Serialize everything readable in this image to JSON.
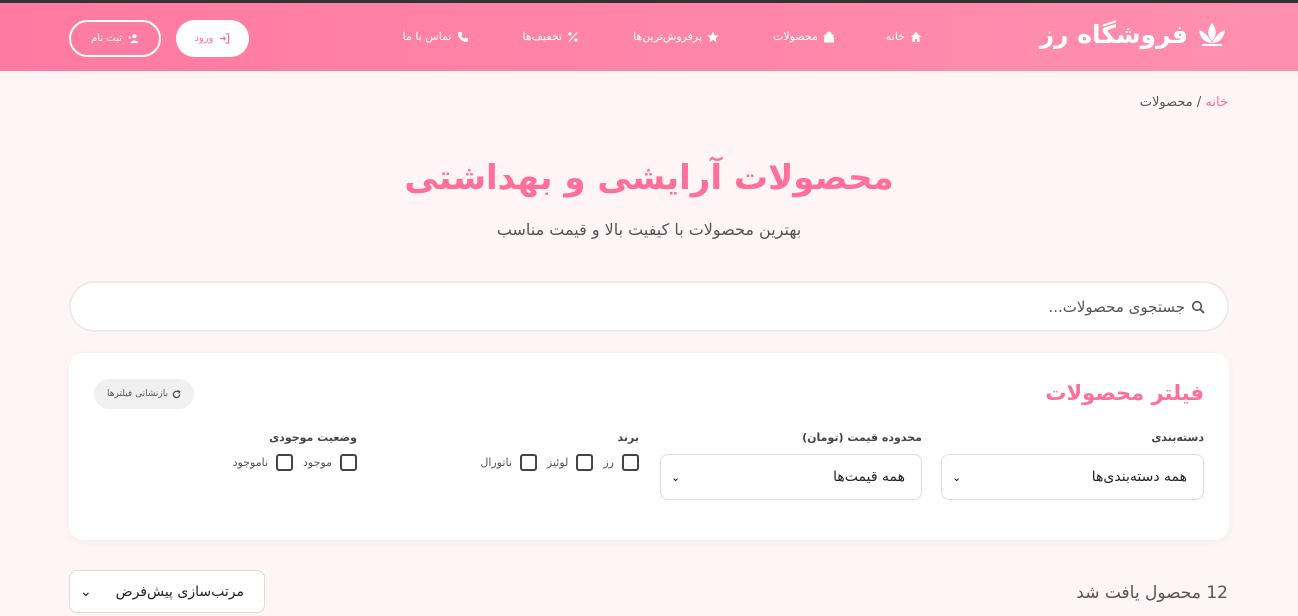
{
  "header": {
    "brand": "فروشگاه رز",
    "nav": [
      {
        "label": "خانه",
        "icon": "home-icon"
      },
      {
        "label": "محصولات",
        "icon": "bag-icon"
      },
      {
        "label": "پرفروش‌ترین‌ها",
        "icon": "star-icon"
      },
      {
        "label": "تخفیف‌ها",
        "icon": "percent-icon"
      },
      {
        "label": "تماس با ما",
        "icon": "phone-icon"
      }
    ],
    "login_label": "ورود",
    "register_label": "ثبت نام"
  },
  "breadcrumb": {
    "home": "خانه",
    "separator": "/",
    "current": "محصولات"
  },
  "hero": {
    "title": "محصولات آرایشی و بهداشتی",
    "subtitle": "بهترین محصولات با کیفیت بالا و قیمت مناسب"
  },
  "search": {
    "placeholder": "جستجوی محصولات..."
  },
  "filters": {
    "title": "فیلتر محصولات",
    "reset_label": "بازنشانی فیلترها",
    "category": {
      "label": "دسته‌بندی",
      "selected": "همه دسته‌بندی‌ها"
    },
    "price": {
      "label": "محدوده قیمت (تومان)",
      "selected": "همه قیمت‌ها"
    },
    "brand": {
      "label": "برند",
      "options": [
        "رز",
        "لوئیز",
        "ناتورال"
      ]
    },
    "stock": {
      "label": "وضعیت موجودی",
      "options": [
        "موجود",
        "ناموجود"
      ]
    }
  },
  "results": {
    "count_text": "12 محصول یافت شد",
    "sort_selected": "مرتب‌سازی پیش‌فرض"
  },
  "colors": {
    "accent": "#ff6f9c",
    "header_gradient_start": "#ff7aa2",
    "header_gradient_end": "#ff8fb0",
    "background": "#fff4f6"
  }
}
